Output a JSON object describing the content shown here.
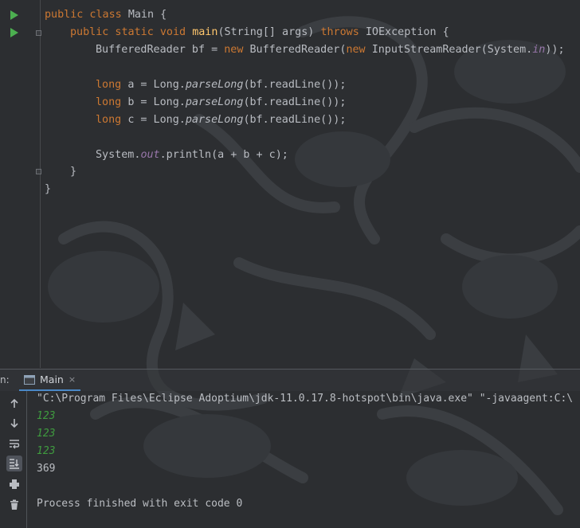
{
  "run_panel": {
    "prefix": "n:",
    "tab_label": "Main",
    "tab_close": "×"
  },
  "console": {
    "command": "\"C:\\Program Files\\Eclipse Adoptium\\jdk-11.0.17.8-hotspot\\bin\\java.exe\" \"-javaagent:C:\\",
    "inputs": [
      "123",
      "123",
      "123"
    ],
    "output": "369",
    "exit_message": "Process finished with exit code 0"
  },
  "code": {
    "l1": {
      "kw": "public class ",
      "name": "Main {"
    },
    "l2": {
      "kw1": "public static void ",
      "fn": "main",
      "args": "(String[] args) ",
      "kw2": "throws ",
      "exc": "IOException {"
    },
    "l3": {
      "decl": "BufferedReader bf = ",
      "kw1": "new ",
      "t1": "BufferedReader(",
      "kw2": "new ",
      "t2": "InputStreamReader(System.",
      "field": "in",
      "end": "));"
    },
    "l4": {
      "kw": "long ",
      "var": "a = Long.",
      "method": "parseLong",
      "end": "(bf.readLine());"
    },
    "l5": {
      "kw": "long ",
      "var": "b = Long.",
      "method": "parseLong",
      "end": "(bf.readLine());"
    },
    "l6": {
      "kw": "long ",
      "var": "c = Long.",
      "method": "parseLong",
      "end": "(bf.readLine());"
    },
    "l7": {
      "pre": "System.",
      "field": "out",
      "end": ".println(a + b + c);"
    },
    "l8": "}",
    "l9": "}"
  },
  "icons": {
    "gutter": [
      "run-icon",
      "run-icon",
      "fold-icon",
      "fold-icon"
    ],
    "toolbar": [
      "arrow-up-icon",
      "arrow-down-icon",
      "soft-wrap-icon",
      "scroll-to-end-icon",
      "print-icon",
      "trash-icon"
    ]
  },
  "colors": {
    "background": "#2b2d30",
    "keyword": "#cc7832",
    "function": "#ffc66d",
    "field": "#9876aa",
    "console_input": "#3f9b3f",
    "run_icon": "#4caf50"
  }
}
